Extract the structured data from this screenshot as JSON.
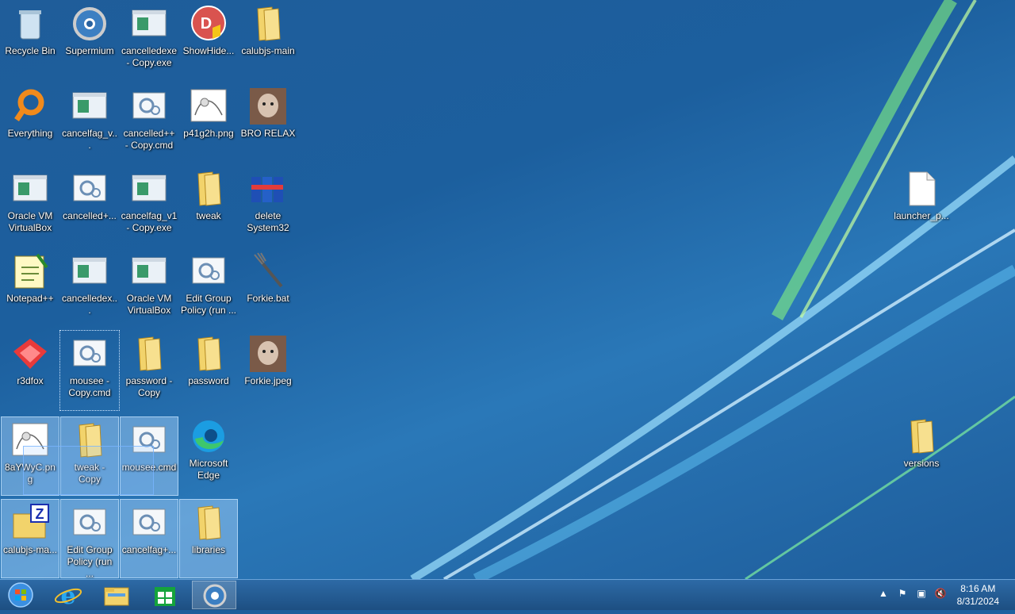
{
  "desktop": {
    "icons": [
      {
        "label": "Recycle Bin",
        "icon": "recycle-bin-icon"
      },
      {
        "label": "Supermium",
        "icon": "browser-icon"
      },
      {
        "label": "cancelledexe - Copy.exe",
        "icon": "exe-window-icon"
      },
      {
        "label": "ShowHide...",
        "icon": "showhide-icon"
      },
      {
        "label": "calubjs-main",
        "icon": "folder-icon"
      },
      {
        "label": "Everything",
        "icon": "search-icon"
      },
      {
        "label": "cancelfag_v...",
        "icon": "exe-window-icon"
      },
      {
        "label": "cancelled++ - Copy.cmd",
        "icon": "gear-script-icon"
      },
      {
        "label": "p41g2h.png",
        "icon": "image-file-icon"
      },
      {
        "label": "BRO RELAX",
        "icon": "photo-icon"
      },
      {
        "label": "Oracle VM VirtualBox",
        "icon": "exe-window-icon"
      },
      {
        "label": "cancelled+...",
        "icon": "gear-script-icon"
      },
      {
        "label": "cancelfag_v1 - Copy.exe",
        "icon": "exe-window-icon"
      },
      {
        "label": "tweak",
        "icon": "folder-icon"
      },
      {
        "label": "delete System32",
        "icon": "cans-icon"
      },
      {
        "label": "Notepad++",
        "icon": "notepad-icon"
      },
      {
        "label": "cancelledex...",
        "icon": "exe-window-icon"
      },
      {
        "label": "Oracle VM VirtualBox",
        "icon": "exe-window-icon"
      },
      {
        "label": "Edit Group Policy (run ...",
        "icon": "gear-script-icon"
      },
      {
        "label": "Forkie.bat",
        "icon": "fork-icon"
      },
      {
        "label": "r3dfox",
        "icon": "r3dfox-icon"
      },
      {
        "label": "mousee - Copy.cmd",
        "icon": "gear-script-icon"
      },
      {
        "label": "password - Copy",
        "icon": "folder-icon"
      },
      {
        "label": "password",
        "icon": "folder-icon"
      },
      {
        "label": "Forkie.jpeg",
        "icon": "photo-icon"
      },
      {
        "label": "8aYWyC.png",
        "icon": "image-file-icon"
      },
      {
        "label": "tweak - Copy",
        "icon": "folder-icon"
      },
      {
        "label": "mousee.cmd",
        "icon": "gear-script-icon"
      },
      {
        "label": "Microsoft Edge",
        "icon": "edge-icon"
      },
      {
        "label": "calubjs-ma...",
        "icon": "zip-folder-icon"
      },
      {
        "label": "Edit Group Policy (run ...",
        "icon": "gear-script-icon"
      },
      {
        "label": "cancelfag+...",
        "icon": "gear-script-icon"
      },
      {
        "label": "libraries",
        "icon": "folder-icon"
      },
      {
        "label": "launcher_p...",
        "icon": "blank-file-icon"
      },
      {
        "label": "versions",
        "icon": "folder-icon"
      }
    ]
  },
  "taskbar": {
    "pinned": [
      "start-orb-icon",
      "internet-explorer-icon",
      "file-explorer-icon",
      "store-icon",
      "supermium-icon"
    ],
    "clock": {
      "time": "8:16 AM",
      "date": "8/31/2024"
    }
  },
  "colors": {
    "accent": "#2d6aa6",
    "folder": "#f2d36b"
  }
}
